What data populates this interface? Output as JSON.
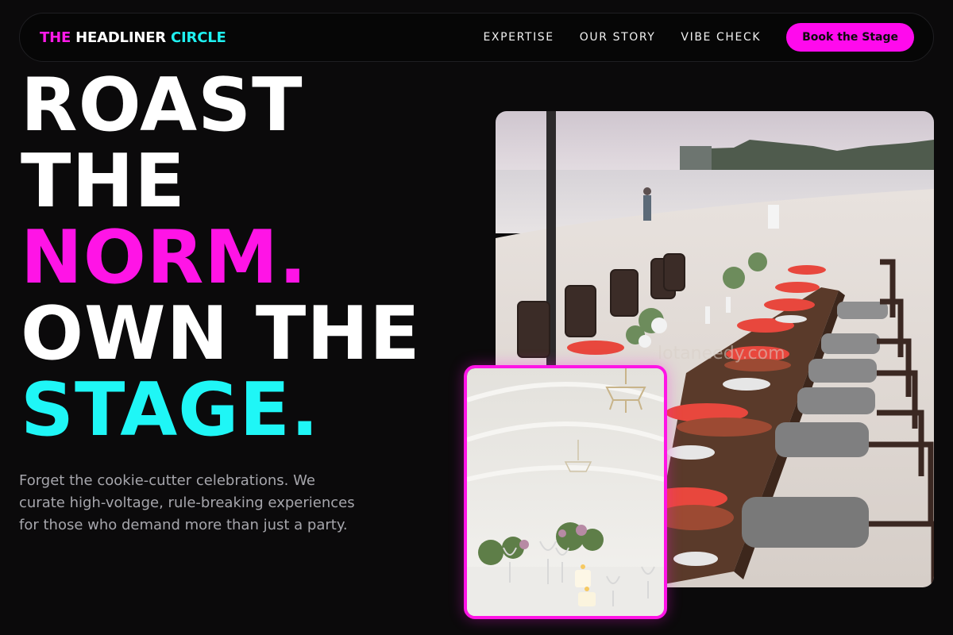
{
  "brand": {
    "part1": "THE",
    "part2": "HEADLINER",
    "part3": "CIRCLE"
  },
  "nav": {
    "links": [
      "EXPERTISE",
      "OUR STORY",
      "VIBE CHECK"
    ],
    "cta_label": "Book the Stage"
  },
  "hero": {
    "line1": "ROAST",
    "line2": "THE",
    "line3": "NORM.",
    "line4": "OWN THE",
    "line5": "STAGE.",
    "description": "Forget the cookie-cutter celebrations. We curate high-voltage, rule-breaking experiences for those who demand more than just a party."
  },
  "images": {
    "main_watermark": "lotaneedy.com"
  },
  "colors": {
    "background": "#0b0a0b",
    "magenta": "#ff14e6",
    "cyan": "#1ff6f6",
    "muted_text": "#a6a6ac"
  }
}
